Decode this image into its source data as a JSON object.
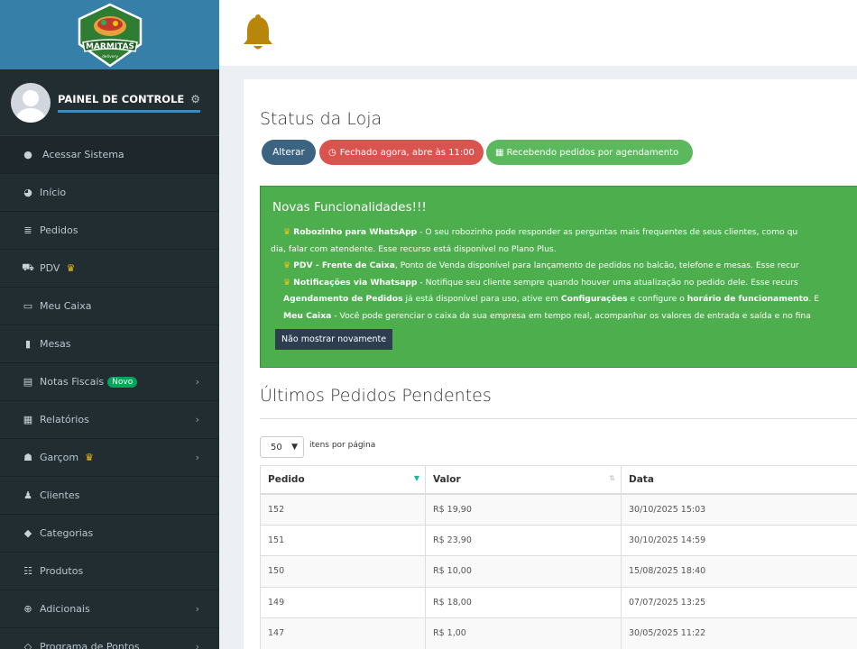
{
  "brand": {
    "name": "MARMITAS",
    "subtitle": "delivery",
    "colors": {
      "sidebar": "#222d32",
      "logo_bg": "#367fa9",
      "badge": "#2e7d32",
      "accent": "#3c8dbc"
    }
  },
  "user": {
    "panel_title": "PAINEL DE CONTROLE"
  },
  "sidebar": {
    "items": [
      {
        "label": "Acessar Sistema",
        "icon": "globe-icon"
      },
      {
        "label": "Início",
        "icon": "dashboard-icon"
      },
      {
        "label": "Pedidos",
        "icon": "list-icon"
      },
      {
        "label": "PDV",
        "icon": "cart-icon",
        "crown": true
      },
      {
        "label": "Meu Caixa",
        "icon": "inbox-icon"
      },
      {
        "label": "Mesas",
        "icon": "bookmark-icon"
      },
      {
        "label": "Notas Fiscais",
        "icon": "file-icon",
        "badge": "Novo",
        "submenu": true
      },
      {
        "label": "Relatórios",
        "icon": "report-icon",
        "submenu": true
      },
      {
        "label": "Garçom",
        "icon": "users-icon",
        "crown": true,
        "submenu": true
      },
      {
        "label": "Clientes",
        "icon": "user-icon"
      },
      {
        "label": "Categorias",
        "icon": "tag-icon"
      },
      {
        "label": "Produtos",
        "icon": "table-icon"
      },
      {
        "label": "Adicionais",
        "icon": "plus-circle-icon",
        "submenu": true
      },
      {
        "label": "Programa de Pontos",
        "icon": "diamond-icon",
        "submenu": true
      }
    ]
  },
  "header": {
    "bell_icon": "bell-icon"
  },
  "store_status": {
    "title": "Status da Loja",
    "change_button": "Alterar",
    "closed_label": "Fechado agora, abre às 11:00",
    "scheduling_label": "Recebendo pedidos por agendamento"
  },
  "news": {
    "title": "Novas Funcionalidades!!!",
    "items": [
      {
        "bold": "Robozinho para WhatsApp",
        "text": " - O seu robozinho pode responder as perguntas mais frequentes de seus clientes, como qu"
      },
      {
        "bold": "",
        "text": "dia, falar com atendente. Esse recurso está disponível no Plano Plus."
      },
      {
        "bold": "PDV - Frente de Caixa",
        "text": ", Ponto de Venda disponível para lançamento de pedidos no balcão, telefone e mesas. Esse recur"
      },
      {
        "bold": "Notificações via Whatsapp",
        "text": " - Notifique seu cliente sempre quando houver uma atualização no pedido dele. Esse recurs"
      },
      {
        "bold": "Agendamento de Pedidos",
        "text": " já está disponível para uso, ative em ",
        "bold2": "Configurações",
        "text2": " e configure o ",
        "bold3": "horário de funcionamento",
        "text3": ". E"
      },
      {
        "bold": "Meu Caixa",
        "text": " - Você pode gerenciar o caixa da sua empresa em tempo real, acompanhar os valores de entrada e saída e no fina"
      }
    ],
    "hide_button": "Não mostrar novamente"
  },
  "orders": {
    "title": "Últimos Pedidos Pendentes",
    "page_size": "50",
    "per_page_label": "itens por página",
    "columns": [
      "Pedido",
      "Valor",
      "Data"
    ],
    "rows": [
      {
        "id": "152",
        "value": "R$ 19,90",
        "date": "30/10/2025 15:03"
      },
      {
        "id": "151",
        "value": "R$ 23,90",
        "date": "30/10/2025 14:59"
      },
      {
        "id": "150",
        "value": "R$ 10,00",
        "date": "15/08/2025 18:40"
      },
      {
        "id": "149",
        "value": "R$ 18,00",
        "date": "07/07/2025 13:25"
      },
      {
        "id": "147",
        "value": "R$ 1,00",
        "date": "30/05/2025 11:22"
      }
    ]
  }
}
